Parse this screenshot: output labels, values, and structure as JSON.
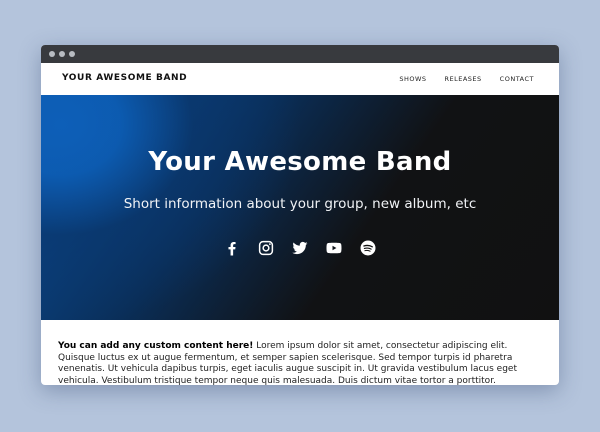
{
  "brand": "YOUR AWESOME BAND",
  "nav": {
    "items": [
      "SHOWS",
      "RELEASES",
      "CONTACT"
    ]
  },
  "hero": {
    "title": "Your Awesome Band",
    "subtitle": "Short information about your group, new album, etc",
    "social_icons": [
      "facebook-icon",
      "instagram-icon",
      "twitter-icon",
      "youtube-icon",
      "spotify-icon"
    ]
  },
  "content": {
    "lead": "You can add any custom content here!",
    "body": " Lorem ipsum dolor sit amet, consectetur adipiscing elit. Quisque luctus ex ut augue fermentum, et semper sapien scelerisque. Sed tempor turpis id pharetra venenatis. Ut vehicula dapibus turpis, eget iaculis augue suscipit in. Ut gravida vestibulum lacus eget vehicula. Vestibulum tristique tempor neque quis malesuada. Duis dictum vitae tortor a porttitor. Curabitur fringilla eros justo, id"
  },
  "colors": {
    "page_bg": "#b4c4dc",
    "titlebar": "#383a3e",
    "hero_blue": "#0a4f9c",
    "hero_dark": "#111111"
  }
}
